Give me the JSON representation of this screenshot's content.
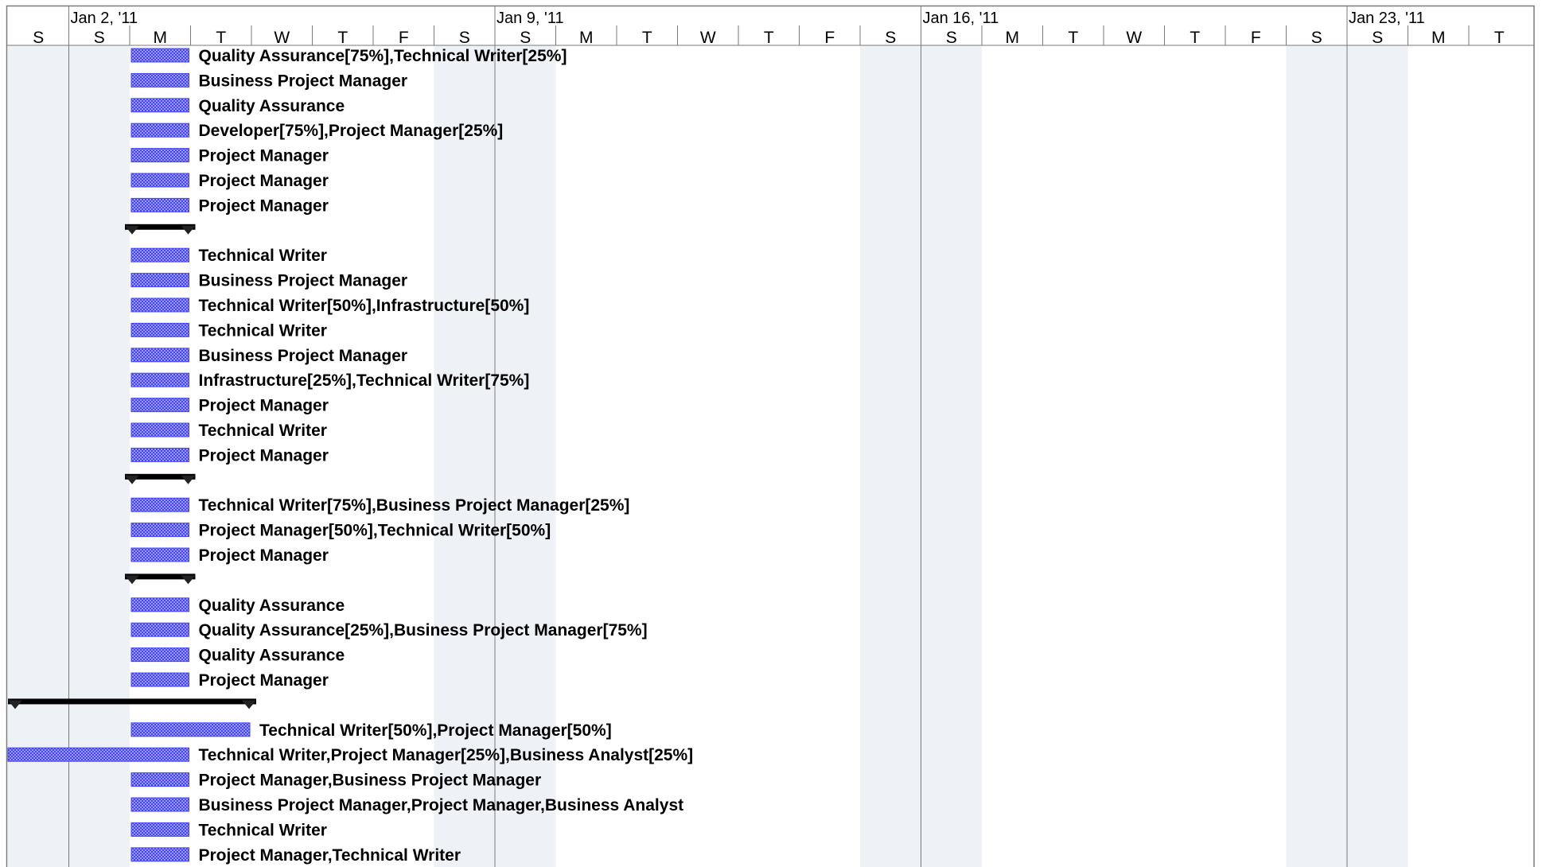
{
  "weeks": [
    "Jan 2, '11",
    "Jan 9, '11",
    "Jan 16, '11",
    "Jan 23, '11"
  ],
  "day_letters": [
    "S",
    "S",
    "M",
    "T",
    "W",
    "T",
    "F",
    "S",
    "S",
    "M",
    "T",
    "W",
    "T",
    "F",
    "S",
    "S",
    "M",
    "T",
    "W",
    "T",
    "F",
    "S",
    "S",
    "M",
    "T"
  ],
  "colors": {
    "bar": "#4343ff",
    "bar_fill": "#9a9aff",
    "summary": "#000000",
    "weekend": "#eef1f6",
    "grid": "#7a7a7a"
  },
  "rows": [
    {
      "type": "task",
      "start": "2011-01-03",
      "end": "2011-01-03",
      "label": "Quality Assurance[75%],Technical Writer[25%]"
    },
    {
      "type": "task",
      "start": "2011-01-03",
      "end": "2011-01-03",
      "label": "Business Project Manager"
    },
    {
      "type": "task",
      "start": "2011-01-03",
      "end": "2011-01-03",
      "label": "Quality Assurance"
    },
    {
      "type": "task",
      "start": "2011-01-03",
      "end": "2011-01-03",
      "label": "Developer[75%],Project Manager[25%]"
    },
    {
      "type": "task",
      "start": "2011-01-03",
      "end": "2011-01-03",
      "label": "Project Manager"
    },
    {
      "type": "task",
      "start": "2011-01-03",
      "end": "2011-01-03",
      "label": "Project Manager"
    },
    {
      "type": "task",
      "start": "2011-01-03",
      "end": "2011-01-03",
      "label": "Project Manager"
    },
    {
      "type": "summary",
      "start": "2011-01-03",
      "end": "2011-01-03",
      "label": ""
    },
    {
      "type": "task",
      "start": "2011-01-03",
      "end": "2011-01-03",
      "label": "Technical Writer"
    },
    {
      "type": "task",
      "start": "2011-01-03",
      "end": "2011-01-03",
      "label": "Business Project Manager"
    },
    {
      "type": "task",
      "start": "2011-01-03",
      "end": "2011-01-03",
      "label": "Technical Writer[50%],Infrastructure[50%]"
    },
    {
      "type": "task",
      "start": "2011-01-03",
      "end": "2011-01-03",
      "label": "Technical Writer"
    },
    {
      "type": "task",
      "start": "2011-01-03",
      "end": "2011-01-03",
      "label": "Business Project Manager"
    },
    {
      "type": "task",
      "start": "2011-01-03",
      "end": "2011-01-03",
      "label": "Infrastructure[25%],Technical Writer[75%]"
    },
    {
      "type": "task",
      "start": "2011-01-03",
      "end": "2011-01-03",
      "label": "Project Manager"
    },
    {
      "type": "task",
      "start": "2011-01-03",
      "end": "2011-01-03",
      "label": "Technical Writer"
    },
    {
      "type": "task",
      "start": "2011-01-03",
      "end": "2011-01-03",
      "label": "Project Manager"
    },
    {
      "type": "summary",
      "start": "2011-01-03",
      "end": "2011-01-03",
      "label": ""
    },
    {
      "type": "task",
      "start": "2011-01-03",
      "end": "2011-01-03",
      "label": "Technical Writer[75%],Business Project Manager[25%]"
    },
    {
      "type": "task",
      "start": "2011-01-03",
      "end": "2011-01-03",
      "label": "Project Manager[50%],Technical Writer[50%]"
    },
    {
      "type": "task",
      "start": "2011-01-03",
      "end": "2011-01-03",
      "label": "Project Manager"
    },
    {
      "type": "summary",
      "start": "2011-01-03",
      "end": "2011-01-03",
      "label": ""
    },
    {
      "type": "task",
      "start": "2011-01-03",
      "end": "2011-01-03",
      "label": "Quality Assurance"
    },
    {
      "type": "task",
      "start": "2011-01-03",
      "end": "2011-01-03",
      "label": "Quality Assurance[25%],Business Project Manager[75%]"
    },
    {
      "type": "task",
      "start": "2011-01-03",
      "end": "2011-01-03",
      "label": "Quality Assurance"
    },
    {
      "type": "task",
      "start": "2011-01-03",
      "end": "2011-01-03",
      "label": "Project Manager"
    },
    {
      "type": "summary",
      "start": "2011-01-01",
      "end": "2011-01-04",
      "label": ""
    },
    {
      "type": "task",
      "start": "2011-01-03",
      "end": "2011-01-04",
      "label": "Technical Writer[50%],Project Manager[50%]"
    },
    {
      "type": "task",
      "start": "2011-01-01",
      "end": "2011-01-03",
      "label": "Technical Writer,Project Manager[25%],Business Analyst[25%]"
    },
    {
      "type": "task",
      "start": "2011-01-03",
      "end": "2011-01-03",
      "label": "Project Manager,Business Project Manager"
    },
    {
      "type": "task",
      "start": "2011-01-03",
      "end": "2011-01-03",
      "label": "Business Project Manager,Project Manager,Business Analyst"
    },
    {
      "type": "task",
      "start": "2011-01-03",
      "end": "2011-01-03",
      "label": "Technical Writer"
    },
    {
      "type": "task",
      "start": "2011-01-03",
      "end": "2011-01-03",
      "label": "Project Manager,Technical Writer"
    }
  ]
}
